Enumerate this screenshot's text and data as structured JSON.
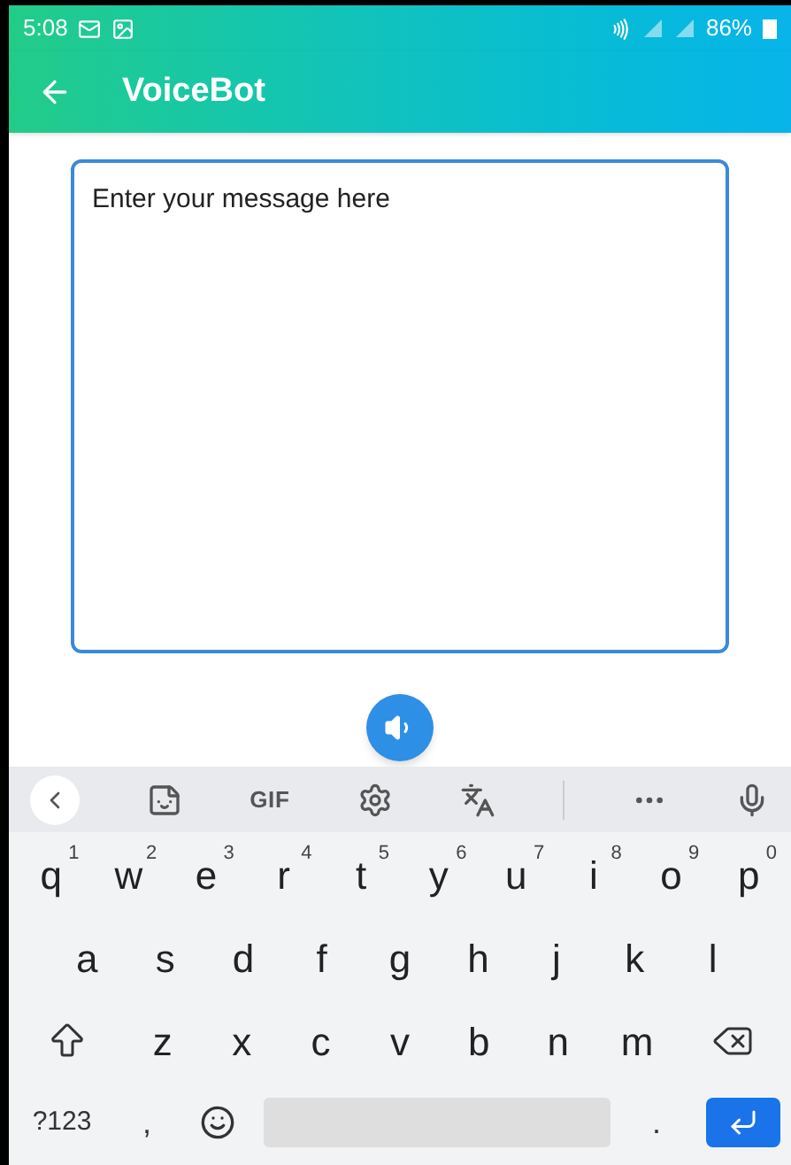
{
  "status_bar": {
    "time": "5:08",
    "battery": "86%"
  },
  "app_bar": {
    "title": "VoiceBot"
  },
  "message_field": {
    "placeholder": "Enter your message here"
  },
  "keyboard": {
    "toolbar": [
      {
        "kind": "back"
      },
      {
        "kind": "sticker"
      },
      {
        "kind": "text",
        "label": "GIF"
      },
      {
        "kind": "settings"
      },
      {
        "kind": "translate"
      },
      {
        "kind": "divider"
      },
      {
        "kind": "more"
      },
      {
        "kind": "mic"
      }
    ],
    "rows": [
      [
        {
          "kind": "char",
          "label": "q",
          "hint": "1"
        },
        {
          "kind": "char",
          "label": "w",
          "hint": "2"
        },
        {
          "kind": "char",
          "label": "e",
          "hint": "3"
        },
        {
          "kind": "char",
          "label": "r",
          "hint": "4"
        },
        {
          "kind": "char",
          "label": "t",
          "hint": "5"
        },
        {
          "kind": "char",
          "label": "y",
          "hint": "6"
        },
        {
          "kind": "char",
          "label": "u",
          "hint": "7"
        },
        {
          "kind": "char",
          "label": "i",
          "hint": "8"
        },
        {
          "kind": "char",
          "label": "o",
          "hint": "9"
        },
        {
          "kind": "char",
          "label": "p",
          "hint": "0"
        }
      ],
      [
        {
          "kind": "char",
          "label": "a"
        },
        {
          "kind": "char",
          "label": "s"
        },
        {
          "kind": "char",
          "label": "d"
        },
        {
          "kind": "char",
          "label": "f"
        },
        {
          "kind": "char",
          "label": "g"
        },
        {
          "kind": "char",
          "label": "h"
        },
        {
          "kind": "char",
          "label": "j"
        },
        {
          "kind": "char",
          "label": "k"
        },
        {
          "kind": "char",
          "label": "l"
        }
      ],
      [
        {
          "kind": "shift"
        },
        {
          "kind": "char",
          "label": "z"
        },
        {
          "kind": "char",
          "label": "x"
        },
        {
          "kind": "char",
          "label": "c"
        },
        {
          "kind": "char",
          "label": "v"
        },
        {
          "kind": "char",
          "label": "b"
        },
        {
          "kind": "char",
          "label": "n"
        },
        {
          "kind": "char",
          "label": "m"
        },
        {
          "kind": "backspace"
        }
      ],
      [
        {
          "kind": "symbols",
          "label": "?123"
        },
        {
          "kind": "char",
          "label": ","
        },
        {
          "kind": "emoji"
        },
        {
          "kind": "space"
        },
        {
          "kind": "char",
          "label": "."
        },
        {
          "kind": "enter"
        }
      ]
    ]
  }
}
